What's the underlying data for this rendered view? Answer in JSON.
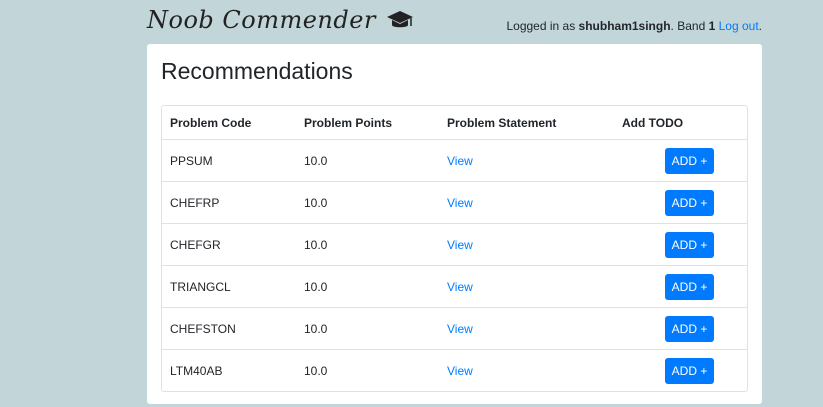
{
  "header": {
    "brand": "Noob Commender",
    "brand_icon": "graduation-cap-icon",
    "login_prefix": "Logged in as ",
    "username": "shubham1singh",
    "band_prefix": ". Band ",
    "band": "1",
    "logout_label": "Log out",
    "trailing": "."
  },
  "main": {
    "title": "Recommendations",
    "columns": [
      "Problem Code",
      "Problem Points",
      "Problem Statement",
      "Add TODO"
    ],
    "rows": [
      {
        "code": "PPSUM",
        "points": "10.0",
        "statement": "View",
        "action": "ADD +"
      },
      {
        "code": "CHEFRP",
        "points": "10.0",
        "statement": "View",
        "action": "ADD +"
      },
      {
        "code": "CHEFGR",
        "points": "10.0",
        "statement": "View",
        "action": "ADD +"
      },
      {
        "code": "TRIANGCL",
        "points": "10.0",
        "statement": "View",
        "action": "ADD +"
      },
      {
        "code": "CHEFSTON",
        "points": "10.0",
        "statement": "View",
        "action": "ADD +"
      },
      {
        "code": "LTM40AB",
        "points": "10.0",
        "statement": "View",
        "action": "ADD +"
      }
    ]
  },
  "colors": {
    "background": "#c2d6da",
    "primary": "#007bff",
    "card": "#ffffff"
  }
}
